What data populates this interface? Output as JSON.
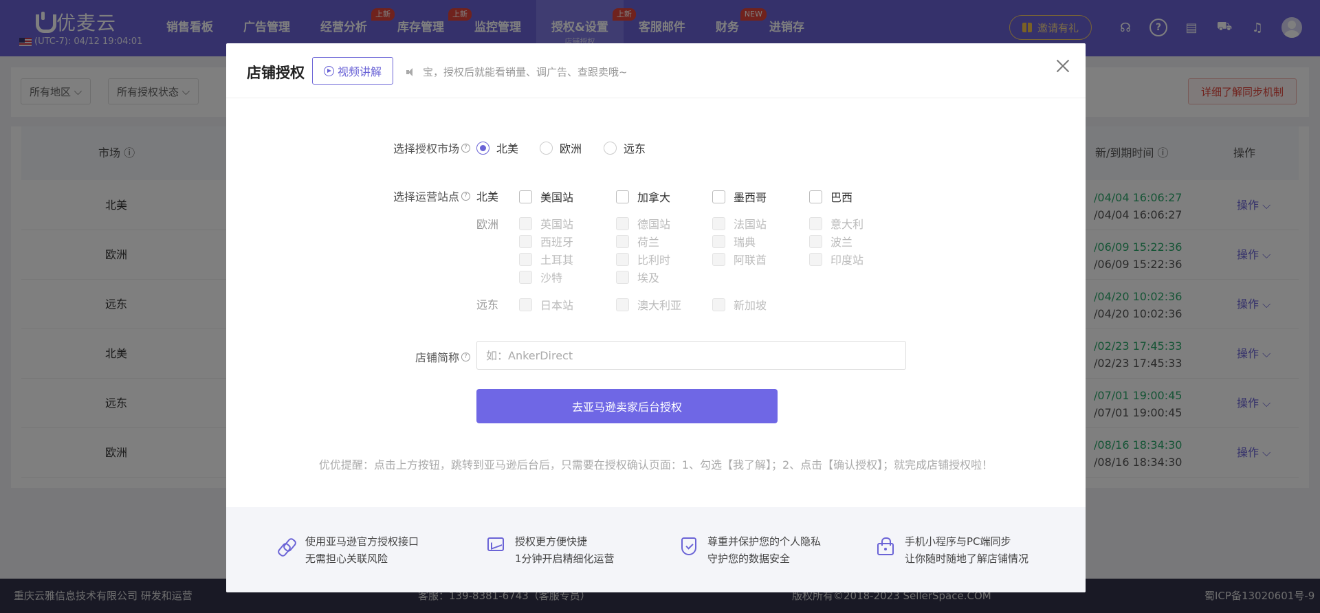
{
  "topnav": {
    "brand": "优麦云",
    "datetime": "(UTC-7): 04/12 19:04:01",
    "menu": [
      {
        "label": "销售看板",
        "badge": ""
      },
      {
        "label": "广告管理",
        "badge": ""
      },
      {
        "label": "经营分析",
        "badge": "上新"
      },
      {
        "label": "库存管理",
        "badge": "上新"
      },
      {
        "label": "监控管理",
        "badge": ""
      },
      {
        "label": "授权&设置",
        "badge": "上新",
        "sub": "店铺授权"
      },
      {
        "label": "客服邮件",
        "badge": ""
      },
      {
        "label": "财务",
        "badge": "NEW"
      },
      {
        "label": "进销存",
        "badge": ""
      }
    ],
    "invite": "邀请有礼"
  },
  "filters": {
    "region": "所有地区",
    "auth_status": "所有授权状态",
    "sync_btn": "详细了解同步机制"
  },
  "table": {
    "headers": {
      "market": "市场",
      "time": "新/到期时间",
      "op": "操作"
    },
    "rows": [
      {
        "market": "北美",
        "t1": "/04/04 16:06:27",
        "t2": "/04/04 16:06:27",
        "op": "操作"
      },
      {
        "market": "欧洲",
        "t1": "/06/09 15:22:36",
        "t2": "/06/09 15:22:36",
        "op": "操作"
      },
      {
        "market": "远东",
        "t1": "/04/20 10:02:36",
        "t2": "/04/20 10:02:36",
        "op": "操作"
      },
      {
        "market": "北美",
        "t1": "/02/23 17:45:33",
        "t2": "/02/23 17:45:33",
        "op": "操作"
      },
      {
        "market": "远东",
        "t1": "/07/01 19:00:45",
        "t2": "/07/01 19:00:45",
        "op": "操作"
      },
      {
        "market": "欧洲",
        "t1": "/08/16 18:34:30",
        "t2": "/08/16 18:34:30",
        "op": "操作"
      }
    ]
  },
  "footer": {
    "company": "重庆云雅信息技术有限公司 研发和运营",
    "service": "客服：139-8381-6743（客服专员）",
    "copyright": "版权所有©2018-2023 SellerSpace.COM",
    "icp": "蜀ICP备13020601号-9"
  },
  "modal": {
    "title": "店铺授权",
    "video_btn": "视频讲解",
    "hint": "宝，授权后就能看销量、调广告、查跟卖哦~",
    "market_label": "选择授权市场",
    "markets": [
      "北美",
      "欧洲",
      "远东"
    ],
    "selected_market": "北美",
    "site_label": "选择运营站点",
    "regions": {
      "na": {
        "label": "北美",
        "sites": [
          "美国站",
          "加拿大",
          "墨西哥",
          "巴西"
        ]
      },
      "eu": {
        "label": "欧洲",
        "sites": [
          "英国站",
          "德国站",
          "法国站",
          "意大利",
          "西班牙",
          "荷兰",
          "瑞典",
          "波兰",
          "土耳其",
          "比利时",
          "阿联酋",
          "印度站",
          "沙特",
          "埃及"
        ]
      },
      "fe": {
        "label": "远东",
        "sites": [
          "日本站",
          "澳大利亚",
          "新加坡"
        ]
      }
    },
    "name_label": "店铺简称",
    "name_placeholder": "如：AnkerDirect",
    "go_btn": "去亚马逊卖家后台授权",
    "tip": "优优提醒：点击上方按钮，跳转到亚马逊后台后，只需要在授权确认页面：1、勾选【我了解】；2、点击【确认授权】；就完成店铺授权啦！",
    "features": [
      {
        "l1": "使用亚马逊官方授权接口",
        "l2": "无需担心关联风险"
      },
      {
        "l1": "授权更方便快捷",
        "l2": "1分钟开启精细化运营"
      },
      {
        "l1": "尊重并保护您的个人隐私",
        "l2": "守护您的数据安全"
      },
      {
        "l1": "手机小程序与PC端同步",
        "l2": "让你随时随地了解店铺情况"
      }
    ]
  }
}
